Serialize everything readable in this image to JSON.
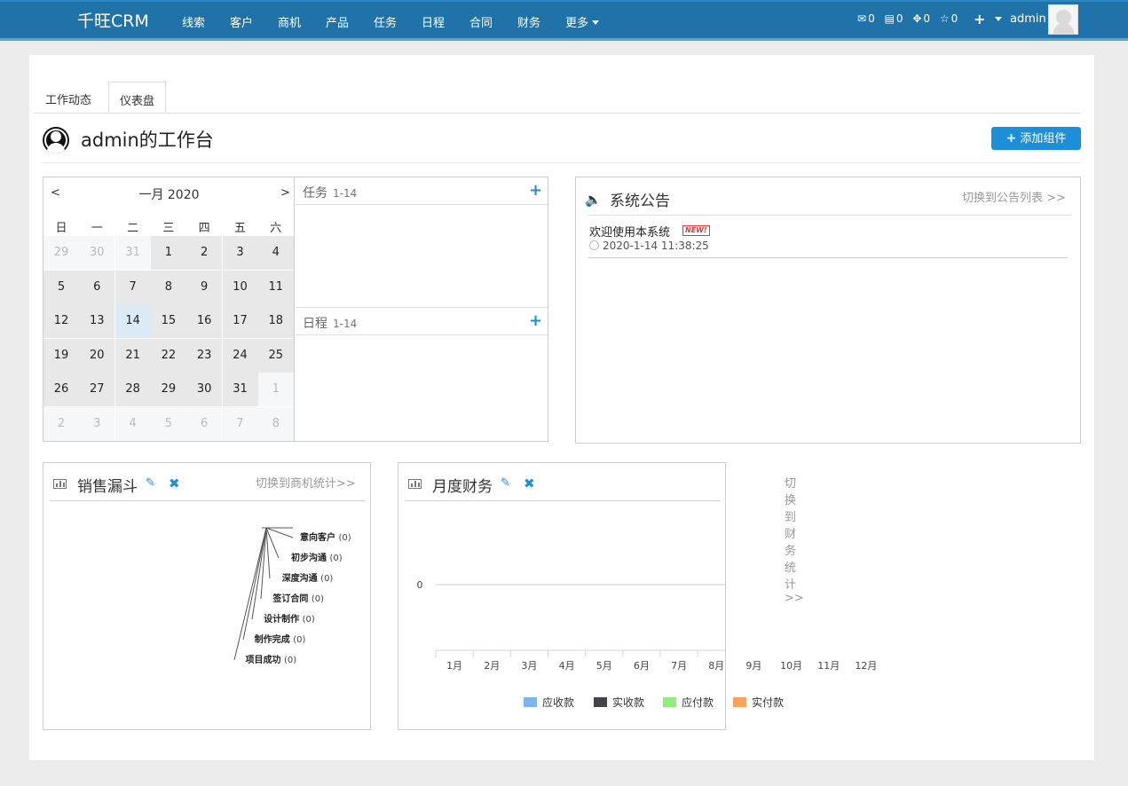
{
  "app": {
    "brand": "千旺CRM"
  },
  "nav": {
    "items": [
      "线索",
      "客户",
      "商机",
      "产品",
      "任务",
      "日程",
      "合同",
      "财务",
      "更多"
    ],
    "counts": [
      {
        "icon": "mail-icon",
        "glyph": "✉",
        "value": "0"
      },
      {
        "icon": "message-icon",
        "glyph": "▤",
        "value": "0"
      },
      {
        "icon": "move-icon",
        "glyph": "✥",
        "value": "0"
      },
      {
        "icon": "star-icon",
        "glyph": "☆",
        "value": "0"
      }
    ],
    "plus": "+",
    "user": "admin"
  },
  "tabs": [
    "工作动态",
    "仪表盘"
  ],
  "page": {
    "title": "admin的工作台",
    "add_widget": "添加组件"
  },
  "calendar": {
    "prev": "<",
    "next": ">",
    "month_label": "一月 2020",
    "weekdays": [
      "日",
      "一",
      "二",
      "三",
      "四",
      "五",
      "六"
    ],
    "weeks": [
      [
        {
          "d": "29",
          "t": "oth"
        },
        {
          "d": "30",
          "t": "oth"
        },
        {
          "d": "31",
          "t": "oth"
        },
        {
          "d": "1",
          "t": "cur"
        },
        {
          "d": "2",
          "t": "cur"
        },
        {
          "d": "3",
          "t": "cur"
        },
        {
          "d": "4",
          "t": "cur"
        }
      ],
      [
        {
          "d": "5",
          "t": "cur"
        },
        {
          "d": "6",
          "t": "cur"
        },
        {
          "d": "7",
          "t": "cur"
        },
        {
          "d": "8",
          "t": "cur"
        },
        {
          "d": "9",
          "t": "cur"
        },
        {
          "d": "10",
          "t": "cur"
        },
        {
          "d": "11",
          "t": "cur"
        }
      ],
      [
        {
          "d": "12",
          "t": "cur"
        },
        {
          "d": "13",
          "t": "cur"
        },
        {
          "d": "14",
          "t": "today"
        },
        {
          "d": "15",
          "t": "cur"
        },
        {
          "d": "16",
          "t": "cur"
        },
        {
          "d": "17",
          "t": "cur"
        },
        {
          "d": "18",
          "t": "cur"
        }
      ],
      [
        {
          "d": "19",
          "t": "cur"
        },
        {
          "d": "20",
          "t": "cur"
        },
        {
          "d": "21",
          "t": "cur"
        },
        {
          "d": "22",
          "t": "cur"
        },
        {
          "d": "23",
          "t": "cur"
        },
        {
          "d": "24",
          "t": "cur"
        },
        {
          "d": "25",
          "t": "cur"
        }
      ],
      [
        {
          "d": "26",
          "t": "cur"
        },
        {
          "d": "27",
          "t": "cur"
        },
        {
          "d": "28",
          "t": "cur"
        },
        {
          "d": "29",
          "t": "cur"
        },
        {
          "d": "30",
          "t": "cur"
        },
        {
          "d": "31",
          "t": "cur"
        },
        {
          "d": "1",
          "t": "oth"
        }
      ],
      [
        {
          "d": "2",
          "t": "oth"
        },
        {
          "d": "3",
          "t": "oth"
        },
        {
          "d": "4",
          "t": "oth"
        },
        {
          "d": "5",
          "t": "oth"
        },
        {
          "d": "6",
          "t": "oth"
        },
        {
          "d": "7",
          "t": "oth"
        },
        {
          "d": "8",
          "t": "oth"
        }
      ]
    ]
  },
  "tasks": {
    "title": "任务",
    "date": "1-14",
    "plus": "+"
  },
  "schedule": {
    "title": "日程",
    "date": "1-14",
    "plus": "+"
  },
  "notice": {
    "title": "系统公告",
    "switch": "切换到公告列表 >>",
    "item_title": "欢迎使用本系统",
    "new_badge": "NEW!",
    "item_time": "2020-1-14  11:38:25"
  },
  "funnel": {
    "title": "销售漏斗",
    "switch": "切换到商机统计>>",
    "stages": [
      {
        "name": "意向客户",
        "count": "(0)"
      },
      {
        "name": "初步沟通",
        "count": "(0)"
      },
      {
        "name": "深度沟通",
        "count": "(0)"
      },
      {
        "name": "签订合同",
        "count": "(0)"
      },
      {
        "name": "设计制作",
        "count": "(0)"
      },
      {
        "name": "制作完成",
        "count": "(0)"
      },
      {
        "name": "项目成功",
        "count": "(0)"
      }
    ]
  },
  "finance": {
    "title": "月度财务",
    "switch": "切换到财务统计 >>",
    "chart_data": {
      "type": "bar",
      "categories": [
        "1月",
        "2月",
        "3月",
        "4月",
        "5月",
        "6月",
        "7月",
        "8月",
        "9月",
        "10月",
        "11月",
        "12月"
      ],
      "yticks": [
        "0"
      ],
      "series": [
        {
          "name": "应收款",
          "color": "#7cb5ec",
          "values": [
            0,
            0,
            0,
            0,
            0,
            0,
            0,
            0,
            0,
            0,
            0,
            0
          ]
        },
        {
          "name": "实收款",
          "color": "#434348",
          "values": [
            0,
            0,
            0,
            0,
            0,
            0,
            0,
            0,
            0,
            0,
            0,
            0
          ]
        },
        {
          "name": "应付款",
          "color": "#90ed7d",
          "values": [
            0,
            0,
            0,
            0,
            0,
            0,
            0,
            0,
            0,
            0,
            0,
            0
          ]
        },
        {
          "name": "实付款",
          "color": "#f7a35c",
          "values": [
            0,
            0,
            0,
            0,
            0,
            0,
            0,
            0,
            0,
            0,
            0,
            0
          ]
        }
      ],
      "grid": true,
      "legend": "bottom"
    }
  }
}
